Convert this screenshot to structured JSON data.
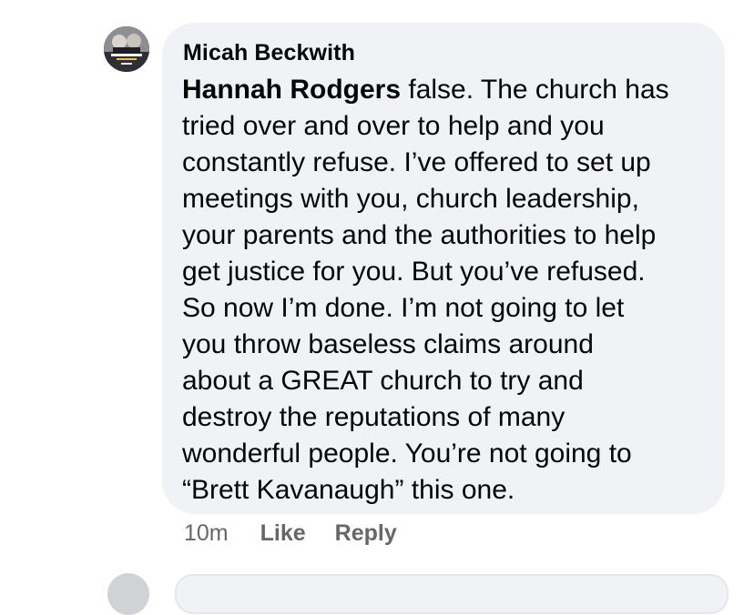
{
  "comment": {
    "author": "Micah Beckwith",
    "avatar_icon": "profile-photo-avatar",
    "mention": "Hannah Rodgers",
    "text_lines": [
      " false. The church has",
      "tried over and over to help and you",
      "constantly refuse. I’ve offered to set up",
      "meetings with you, church leadership,",
      "your parents and the authorities to help",
      "get justice for you. But you’ve refused.",
      "So now I’m done. I’m not going to let",
      "you throw baseless claims around",
      "about a GREAT church to try and",
      "destroy the reputations of many",
      "wonderful people. You’re not going to",
      "“Brett Kavanaugh” this one."
    ],
    "timestamp": "10m",
    "like_label": "Like",
    "reply_label": "Reply"
  },
  "colors": {
    "bubble_background": "#f0f2f5",
    "text": "#050505",
    "secondary_text": "#65676b"
  }
}
